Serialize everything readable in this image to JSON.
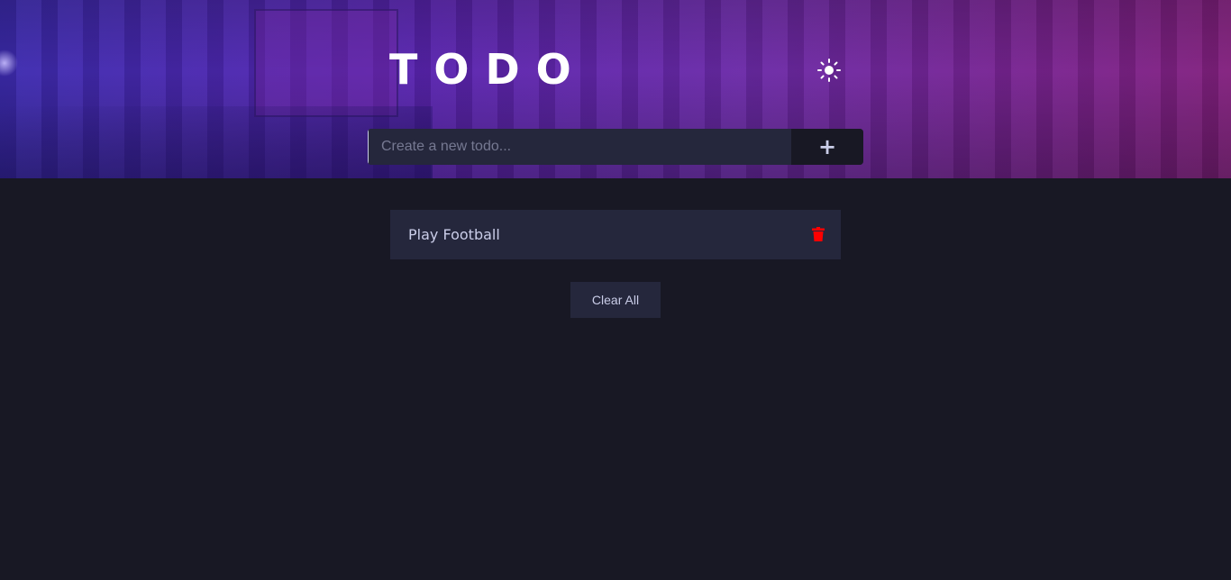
{
  "header": {
    "title": "TODO",
    "theme_toggle_icon": "sun-icon"
  },
  "new_todo": {
    "placeholder": "Create a new todo...",
    "value": "",
    "add_label": "+"
  },
  "todos": [
    {
      "text": "Play Football",
      "delete_icon": "trash-icon"
    }
  ],
  "actions": {
    "clear_all_label": "Clear All"
  },
  "colors": {
    "background": "#181824",
    "card": "#25273c",
    "text": "#cacde8",
    "delete": "#ff0000",
    "gradient_start": "#3d2bb0",
    "gradient_end": "#82207e"
  }
}
